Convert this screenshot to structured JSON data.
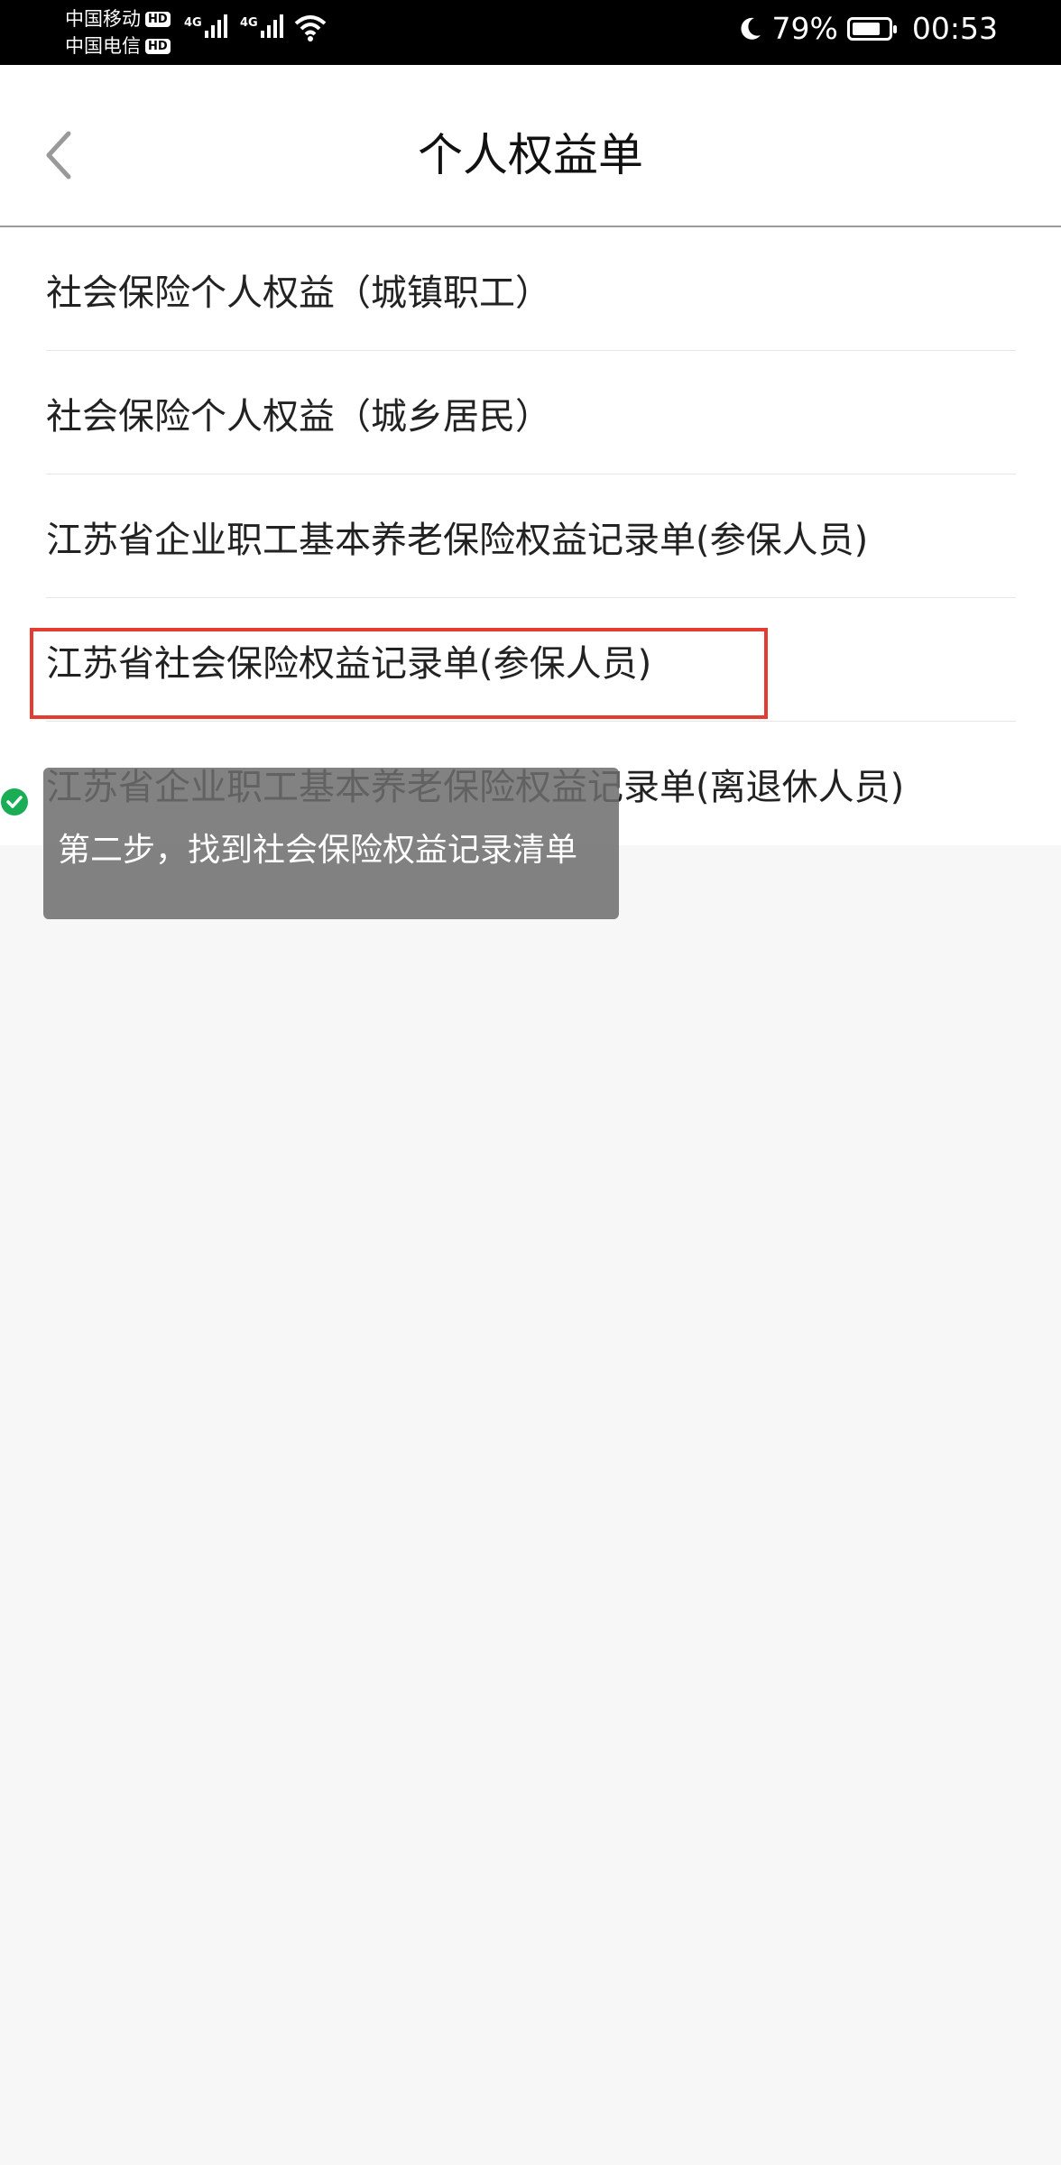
{
  "status_bar": {
    "carrier_1": "中国移动",
    "carrier_2": "中国电信",
    "hd_badge": "HD",
    "network_type": "4G",
    "battery_percent": "79%",
    "battery_level": 0.79,
    "time": "00:53",
    "icons": [
      "signal-icon",
      "wifi-icon",
      "moon-icon",
      "battery-icon"
    ]
  },
  "nav": {
    "back_icon": "chevron-left-icon",
    "title": "个人权益单"
  },
  "list": {
    "items": [
      {
        "label": "社会保险个人权益（城镇职工）"
      },
      {
        "label": "社会保险个人权益（城乡居民）"
      },
      {
        "label": "江苏省企业职工基本养老保险权益记录单(参保人员)"
      },
      {
        "label": "江苏省社会保险权益记录单(参保人员)"
      },
      {
        "label": "江苏省企业职工基本养老保险权益记录单(离退休人员)"
      }
    ]
  },
  "annotation": {
    "highlight_color": "#e23d30",
    "tooltip_text": "第二步，找到社会保险权益记录清单",
    "check_color": "#1aad55"
  }
}
